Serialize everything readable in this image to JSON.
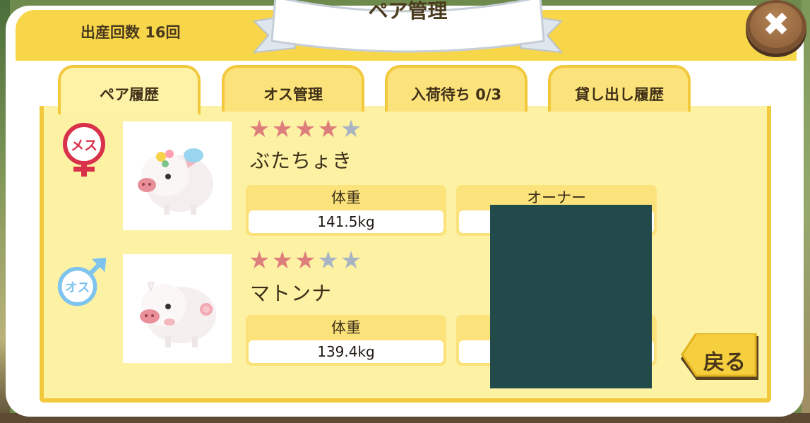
{
  "header": {
    "birth_count": "出産回数 16回",
    "title": "ペア管理",
    "close_glyph": "✖"
  },
  "tabs": [
    {
      "label": "ペア履歴",
      "active": true
    },
    {
      "label": "オス管理",
      "active": false
    },
    {
      "label": "入荷待ち 0/3",
      "active": false
    },
    {
      "label": "貸し出し履歴",
      "active": false
    }
  ],
  "pair": {
    "female": {
      "sex_label": "メス",
      "stars": "★★★★",
      "stars_off": "★",
      "rating": 4,
      "rating_max": 5,
      "name": "ぶたちょき",
      "weight_label": "体重",
      "weight": "141.5kg",
      "owner_label": "オーナー"
    },
    "male": {
      "sex_label": "オス",
      "stars": "★★★",
      "stars_off": "★★",
      "rating": 3,
      "rating_max": 5,
      "name": "マトンナ",
      "weight_label": "体重",
      "weight": "139.4kg"
    }
  },
  "back_label": "戻る",
  "colors": {
    "header": "#f7d64a",
    "panel": "#fdf1a4",
    "tab_border": "#f2c93d",
    "star_on": "#de7e7c",
    "star_off": "#a9b4c3",
    "female_icon": "#d9314a",
    "male_icon": "#7ec4ee",
    "redaction": "#224a4a"
  }
}
